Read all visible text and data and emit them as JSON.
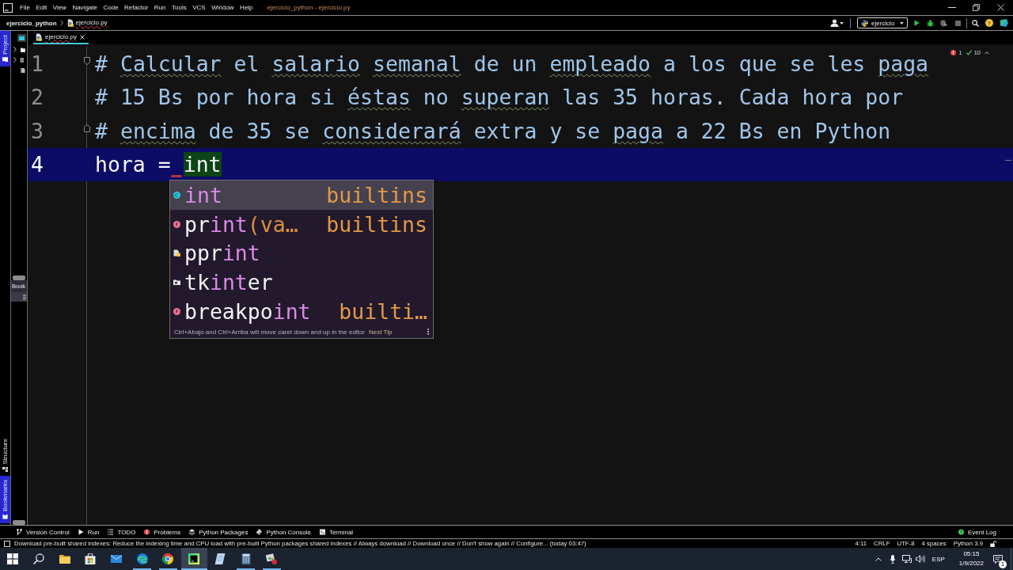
{
  "title_bar": {
    "menu": [
      "File",
      "Edit",
      "View",
      "Navigate",
      "Code",
      "Refactor",
      "Run",
      "Tools",
      "VCS",
      "Window",
      "Help"
    ],
    "title": "ejercicio_python - ejercicio.py"
  },
  "navigation_bar": {
    "project": "ejercicio_python",
    "file": {
      "label": "ejercicio.py",
      "errors": true
    },
    "run_configuration": "ejercicio"
  },
  "tool_stripe": [
    {
      "label": "Project",
      "kind": "project",
      "selected": true
    },
    {
      "label": "Structure",
      "kind": "structure",
      "selected": false
    },
    {
      "label": "Bookmarks",
      "kind": "bookmarks",
      "selected": true
    }
  ],
  "project_panel": {
    "rows": [
      {
        "kind": "folder",
        "expandable": true
      },
      {
        "kind": "library",
        "expandable": true
      },
      {
        "kind": "scratch",
        "expandable": false
      }
    ],
    "bookmarks_header": "Book"
  },
  "editor": {
    "tabs": [
      {
        "label": "ejercicio.py",
        "selected": true,
        "errors": true
      }
    ],
    "inspections": {
      "errors": "1",
      "warnings": "10"
    },
    "lines": [
      {
        "number": "1",
        "current": false,
        "fold_start": true,
        "fold_end": false,
        "segments": [
          {
            "kind": "comment",
            "text": "# "
          },
          {
            "kind": "typo",
            "text": "Calcular"
          },
          {
            "kind": "comment",
            "text": " el "
          },
          {
            "kind": "typo",
            "text": "salario "
          },
          {
            "kind": "typo",
            "text": "semanal"
          },
          {
            "kind": "comment",
            "text": " de un "
          },
          {
            "kind": "typo",
            "text": "empleado"
          },
          {
            "kind": "comment",
            "text": " a los que se les "
          },
          {
            "kind": "typo",
            "text": "paga"
          }
        ]
      },
      {
        "number": "2",
        "current": false,
        "fold_start": false,
        "fold_end": false,
        "segments": [
          {
            "kind": "comment",
            "text": "# 15 Bs por hora si "
          },
          {
            "kind": "typo",
            "text": "éstas"
          },
          {
            "kind": "comment",
            "text": " no "
          },
          {
            "kind": "typo",
            "text": "superan"
          },
          {
            "kind": "comment",
            "text": " las 35 horas. Cada hora por"
          }
        ]
      },
      {
        "number": "3",
        "current": false,
        "fold_start": false,
        "fold_end": true,
        "segments": [
          {
            "kind": "comment",
            "text": "# "
          },
          {
            "kind": "typo",
            "text": "encima"
          },
          {
            "kind": "comment",
            "text": " de 35 se "
          },
          {
            "kind": "typo",
            "text": "considerará"
          },
          {
            "kind": "comment",
            "text": " extra y se "
          },
          {
            "kind": "typo",
            "text": "paga"
          },
          {
            "kind": "comment",
            "text": " a 22 Bs en Python"
          }
        ]
      },
      {
        "number": "4",
        "current": true,
        "fold_start": false,
        "fold_end": false,
        "segments": [
          {
            "kind": "code",
            "text": "hora = "
          },
          {
            "kind": "match",
            "text": "int",
            "error_before": true
          }
        ]
      }
    ]
  },
  "completion_popup": {
    "items": [
      {
        "kind": "class",
        "selected": true,
        "segments": [
          {
            "kind": "match",
            "text": "int"
          }
        ],
        "type": "builtins"
      },
      {
        "kind": "function",
        "selected": false,
        "segments": [
          {
            "kind": "plain",
            "text": "pr"
          },
          {
            "kind": "match",
            "text": "int"
          },
          {
            "kind": "params",
            "text": "(va…"
          }
        ],
        "type": "builtins"
      },
      {
        "kind": "module",
        "selected": false,
        "segments": [
          {
            "kind": "plain",
            "text": "ppr"
          },
          {
            "kind": "match",
            "text": "int"
          }
        ]
      },
      {
        "kind": "package",
        "selected": false,
        "segments": [
          {
            "kind": "plain",
            "text": "tk"
          },
          {
            "kind": "match",
            "text": "int"
          },
          {
            "kind": "plain",
            "text": "er"
          }
        ]
      },
      {
        "kind": "function",
        "selected": false,
        "segments": [
          {
            "kind": "plain",
            "text": "breakpo"
          },
          {
            "kind": "match",
            "text": "int"
          }
        ],
        "type": "builti…"
      }
    ],
    "hint": "Ctrl+Abajo and Ctrl+Arriba will move caret down and up in the editor",
    "link": "Next Tip"
  },
  "tool_windows": [
    {
      "label": "Version Control",
      "kind": "vcs"
    },
    {
      "label": "Run",
      "kind": "run"
    },
    {
      "label": "TODO",
      "kind": "todo"
    },
    {
      "label": "Problems",
      "kind": "problems"
    },
    {
      "label": "Python Packages",
      "kind": "packages"
    },
    {
      "label": "Python Console",
      "kind": "console"
    },
    {
      "label": "Terminal",
      "kind": "terminal"
    }
  ],
  "event_log": "Event Log",
  "status_bar": {
    "message": "Download pre-built shared indexes: Reduce the indexing time and CPU load with pre-built Python packages shared indexes // Always download // Download once // Don't show again // Configure... (today 03:47)",
    "items": [
      "4:11",
      "CRLF",
      "UTF-8",
      "4 spaces",
      "Python 3.9"
    ]
  },
  "taskbar": {
    "apps": [
      {
        "kind": "start",
        "selected": false,
        "running": false
      },
      {
        "kind": "search",
        "selected": false,
        "running": false
      },
      {
        "kind": "files",
        "selected": false,
        "running": false
      },
      {
        "kind": "store",
        "selected": false,
        "running": false
      },
      {
        "kind": "mail",
        "selected": false,
        "running": false
      },
      {
        "kind": "swirl_browser",
        "selected": false,
        "running": true
      },
      {
        "kind": "round_browser",
        "selected": false,
        "running": true
      },
      {
        "kind": "ide",
        "selected": true,
        "running": true
      },
      {
        "kind": "notepad",
        "selected": false,
        "running": false
      },
      {
        "kind": "calculator",
        "selected": false,
        "running": true
      },
      {
        "kind": "photo",
        "selected": false,
        "running": true
      }
    ],
    "language": "ESP",
    "time": "05:15",
    "date": "1/9/2022",
    "notifications": "1"
  }
}
